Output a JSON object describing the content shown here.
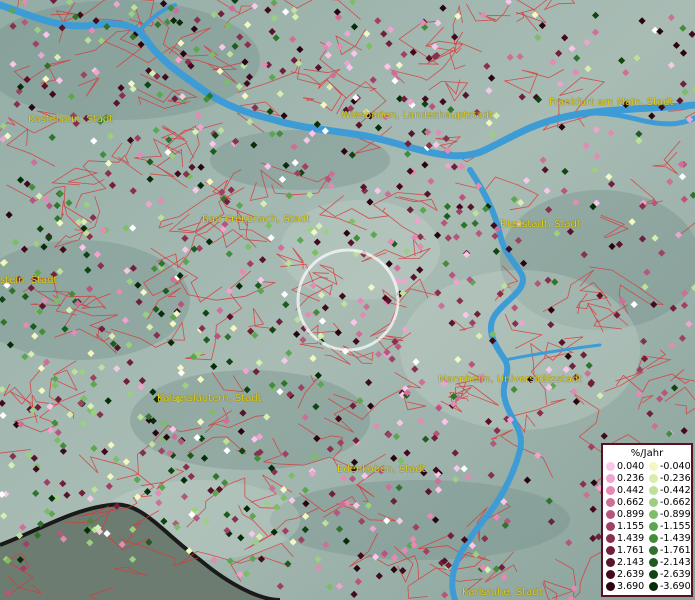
{
  "map": {
    "cities": [
      {
        "name": "Kastellaun, Stadt"
      },
      {
        "name": "Wiesbaden, Landeshauptstadt"
      },
      {
        "name": "Frankfurt am Main, Stadt"
      },
      {
        "name": "Bad Kreuznach, Stadt"
      },
      {
        "name": "Riedstadt, Stadt"
      },
      {
        "name": "stein, Stadt"
      },
      {
        "name": "Mannheim, Universitätsstadt"
      },
      {
        "name": "Kaiserslautern, Stadt"
      },
      {
        "name": "Edenkoben, Stadt"
      },
      {
        "name": "Karlsruhe, Stadt"
      }
    ],
    "colors": {
      "river": "#3d9bd6",
      "border": "#d9383a",
      "terrain": "#8fa8a0"
    }
  },
  "legend": {
    "title": "%/Jahr",
    "positive": [
      {
        "label": "0.040",
        "color": "#f7c6e8"
      },
      {
        "label": "0.236",
        "color": "#eea4cf"
      },
      {
        "label": "0.442",
        "color": "#e38ab5"
      },
      {
        "label": "0.662",
        "color": "#cf6f98"
      },
      {
        "label": "0.899",
        "color": "#b8557c"
      },
      {
        "label": "1.155",
        "color": "#a04062"
      },
      {
        "label": "1.439",
        "color": "#88304c"
      },
      {
        "label": "1.761",
        "color": "#70203a"
      },
      {
        "label": "2.143",
        "color": "#58142a"
      },
      {
        "label": "2.639",
        "color": "#420a1c"
      },
      {
        "label": "3.690",
        "color": "#2a0410"
      }
    ],
    "negative": [
      {
        "label": "-0.040",
        "color": "#f3f7c2"
      },
      {
        "label": "-0.236",
        "color": "#d8edb0"
      },
      {
        "label": "-0.442",
        "color": "#bde09a"
      },
      {
        "label": "-0.662",
        "color": "#9ccf80"
      },
      {
        "label": "-0.899",
        "color": "#7cbd66"
      },
      {
        "label": "-1.155",
        "color": "#5da650"
      },
      {
        "label": "-1.439",
        "color": "#438c3c"
      },
      {
        "label": "-1.761",
        "color": "#2f732c"
      },
      {
        "label": "-2.143",
        "color": "#1d5b1e"
      },
      {
        "label": "-2.639",
        "color": "#104412"
      },
      {
        "label": "-3.690",
        "color": "#062c08"
      }
    ]
  }
}
